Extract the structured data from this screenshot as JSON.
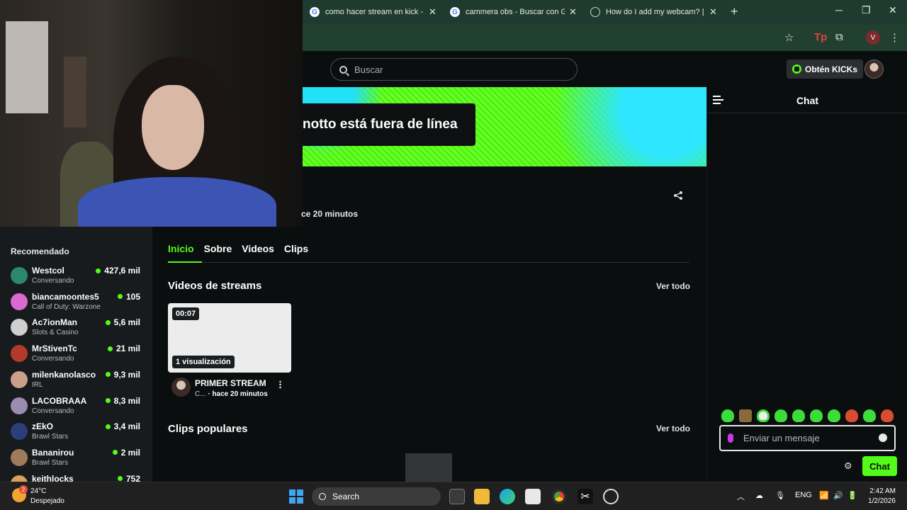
{
  "browser": {
    "tabs": [
      {
        "title": "como hacer stream en kick - Bu",
        "icon": "google-icon"
      },
      {
        "title": "cammera obs - Buscar con Goo",
        "icon": "google-icon"
      },
      {
        "title": "How do I add my webcam? | Ol",
        "icon": "github-icon"
      }
    ],
    "close_glyph": "✕",
    "new_tab_glyph": "+",
    "profile_letter": "V"
  },
  "header": {
    "search_placeholder": "Buscar",
    "kicks_label": "Obtén KICKs"
  },
  "banner": {
    "offline_text": "notto está fuera de línea"
  },
  "stream_info": {
    "ago": "ce 20 minutos"
  },
  "chat": {
    "title": "Chat",
    "input_placeholder": "Enviar un mensaje",
    "send_label": "Chat"
  },
  "sidebar": {
    "title": "Recomendado",
    "channels": [
      {
        "name": "Westcol",
        "category": "Conversando",
        "viewers": "427,6 mil",
        "color": "#2b8a6b"
      },
      {
        "name": "biancamoontes5",
        "category": "Call of Duty: Warzone",
        "viewers": "105",
        "color": "#d86ad0"
      },
      {
        "name": "Ac7ionMan",
        "category": "Slots & Casino",
        "viewers": "5,6 mil",
        "color": "#cfcfcf"
      },
      {
        "name": "MrStivenTc",
        "category": "Conversando",
        "viewers": "21 mil",
        "color": "#b23a2a"
      },
      {
        "name": "milenkanolasco",
        "category": "IRL",
        "viewers": "9,3 mil",
        "color": "#caa08a"
      },
      {
        "name": "LACOBRAAA",
        "category": "Conversando",
        "viewers": "8,3 mil",
        "color": "#9b8cb0"
      },
      {
        "name": "zEkO",
        "category": "Brawl Stars",
        "viewers": "3,4 mil",
        "color": "#2a3f7a"
      },
      {
        "name": "Bananirou",
        "category": "Brawl Stars",
        "viewers": "2 mil",
        "color": "#a07a5a"
      },
      {
        "name": "keithlocks",
        "category": "",
        "viewers": "752",
        "color": "#d6a35a"
      }
    ]
  },
  "main": {
    "tabs": [
      "Inicio",
      "Sobre",
      "Videos",
      "Clips"
    ],
    "sections": {
      "videos_title": "Videos de streams",
      "clips_title": "Clips populares",
      "see_all": "Ver todo"
    },
    "video": {
      "duration": "00:07",
      "views": "1 visualización",
      "title": "PRIMER STREAM",
      "meta_prefix": "C...",
      "meta_ago": "· hace 20 minutos"
    }
  },
  "taskbar": {
    "temperature": "24°C",
    "condition": "Despejado",
    "weather_badge": "2",
    "search_label": "Search",
    "language": "ENG",
    "time": "2:42 AM",
    "date": "1/2/2026"
  }
}
